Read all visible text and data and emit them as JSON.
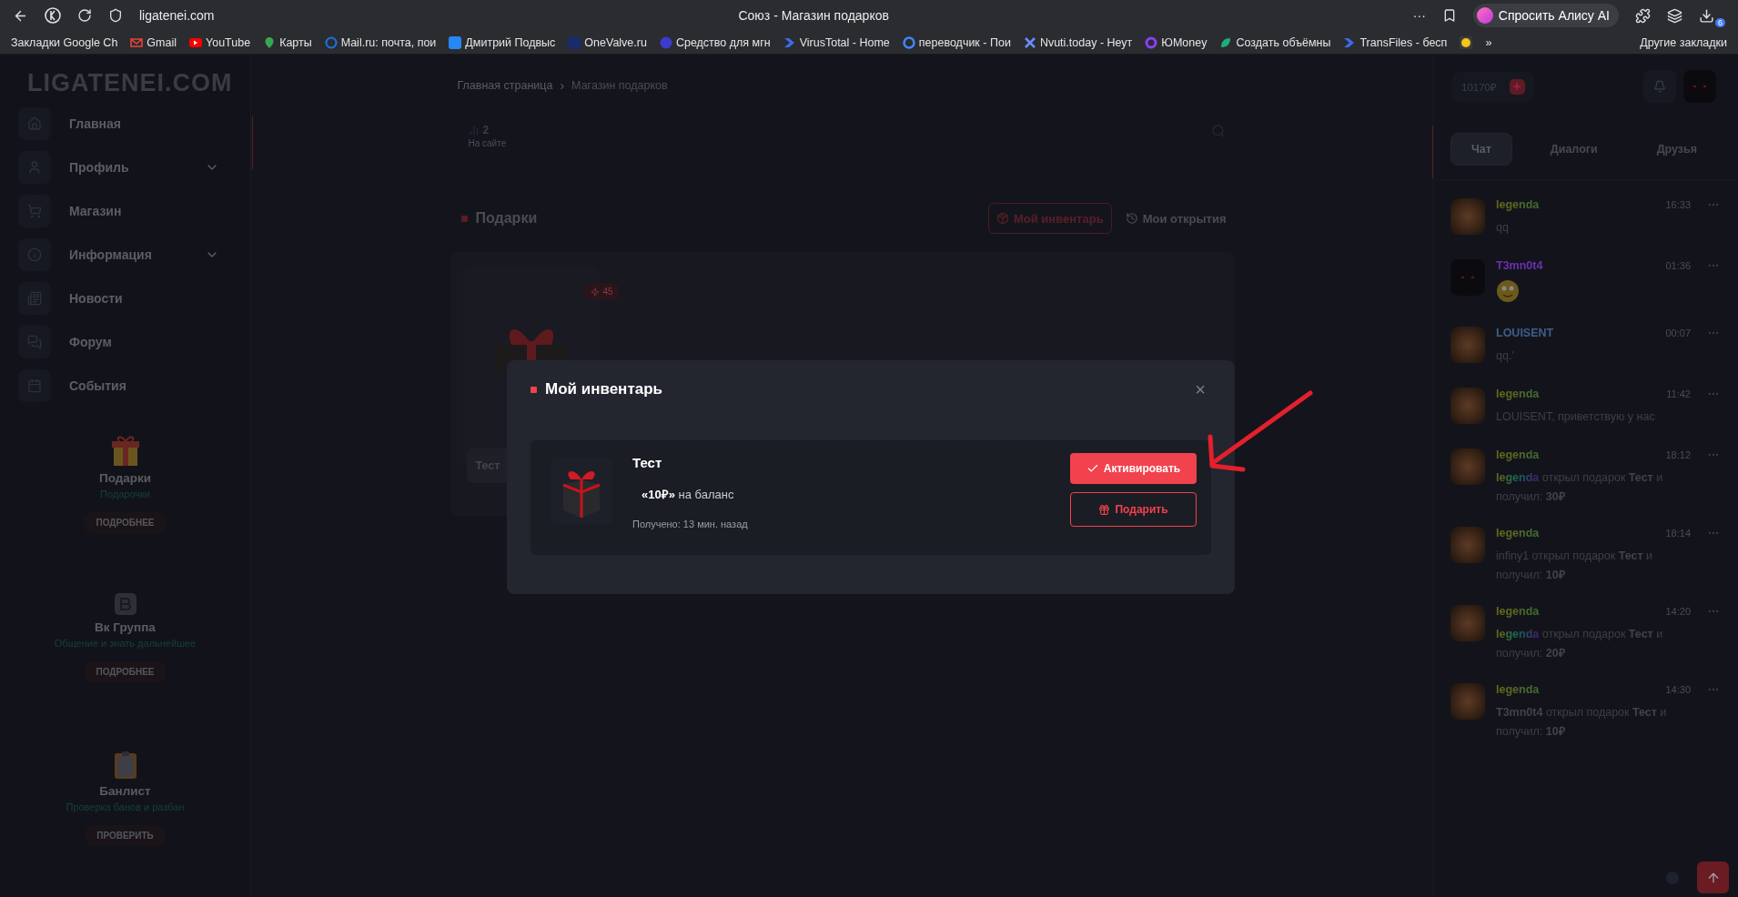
{
  "browser": {
    "address": "ligatenei.com",
    "title": "Союз - Магазин подарков",
    "more": "···",
    "assistant": "Спросить Алису AI",
    "downloads_badge": "6",
    "overflow": "»",
    "other_bookmarks": "Другие закладки",
    "bookmarks": [
      {
        "label": "Закладки Google Ch"
      },
      {
        "label": "Gmail",
        "kind": "mail"
      },
      {
        "label": "YouTube",
        "kind": "play"
      },
      {
        "label": "Карты",
        "kind": "pin"
      },
      {
        "label": "Mail.ru: почта, пои",
        "kind": "at"
      },
      {
        "label": "Дмитрий Подвыс",
        "kind": "vk"
      },
      {
        "label": "OneValve.ru",
        "kind": "square"
      },
      {
        "label": "Средство для мгн",
        "kind": "circle"
      },
      {
        "label": "VirusTotal - Home",
        "kind": "chevron"
      },
      {
        "label": "переводчик - Пои",
        "kind": "google"
      },
      {
        "label": "Nvuti.today - Неут",
        "kind": "cross"
      },
      {
        "label": "ЮMoney",
        "kind": "ring"
      },
      {
        "label": "Создать объёмны",
        "kind": "leaf"
      },
      {
        "label": "TransFiles - бесп",
        "kind": "chevron"
      },
      {
        "kind": "coin"
      }
    ]
  },
  "sidebar": {
    "logo": "LIGATENEI.COM",
    "menu": [
      {
        "label": "Главная",
        "kind": "home"
      },
      {
        "label": "Профиль",
        "kind": "user"
      },
      {
        "label": "Магазин",
        "kind": "cart"
      },
      {
        "label": "Информация",
        "kind": "info"
      },
      {
        "label": "Новости",
        "kind": "news"
      },
      {
        "label": "Форум",
        "kind": "chat"
      },
      {
        "label": "События",
        "kind": "calendar"
      }
    ],
    "cards": [
      {
        "kind": "gift",
        "title": "Подарки",
        "subtitle": "Подарочки",
        "button": "ПОДРОБНЕЕ"
      },
      {
        "kind": "vk",
        "title": "Вк Группа",
        "subtitle": "Общение и знать дальнейшее",
        "button": "ПОДРОБНЕЕ"
      },
      {
        "kind": "clipboard",
        "title": "Банлист",
        "subtitle": "Проверка банов и разбан",
        "button": "ПРОВЕРИТЬ"
      }
    ]
  },
  "main": {
    "breadcrumb": [
      {
        "label": "Главная страница"
      },
      {
        "label": "Магазин подарков"
      }
    ],
    "separator": "›",
    "online": {
      "count": "2",
      "label": "На сайте"
    },
    "section_title": "Подарки",
    "views": [
      {
        "label": "Мой инвентарь",
        "kind": "package",
        "selected": true
      },
      {
        "label": "Мои открытия",
        "kind": "history",
        "selected": false
      }
    ],
    "gift": {
      "badge": "45",
      "button": "Тест"
    }
  },
  "chat": {
    "balance": "10170₽",
    "tabs": [
      {
        "label": "Чат",
        "selected": true
      },
      {
        "label": "Диалоги",
        "selected": false
      },
      {
        "label": "Друзья",
        "selected": false
      }
    ],
    "messages": [
      {
        "avatar": {
          "kind": "portrait"
        },
        "name": {
          "text": "legenda",
          "kind": "rainbow"
        },
        "time": "16:33",
        "kind": "text",
        "text": "qq"
      },
      {
        "avatar": {
          "kind": "dark"
        },
        "name": {
          "text": "T3mn0t4",
          "kind": "plain",
          "color": "#6a30b0"
        },
        "time": "01:36",
        "kind": "emoji"
      },
      {
        "avatar": {
          "kind": "portrait"
        },
        "name": {
          "text": "LOUISENT",
          "kind": "plain",
          "color": "#3d5f8a"
        },
        "time": "00:07",
        "kind": "text",
        "text": "qq.'"
      },
      {
        "avatar": {
          "kind": "portrait"
        },
        "name": {
          "text": "legenda",
          "kind": "rainbow"
        },
        "time": "11:42",
        "kind": "text",
        "text": "LOUISENT, приветствую у нас"
      },
      {
        "avatar": {
          "kind": "portrait"
        },
        "name": {
          "text": "legenda",
          "kind": "rainbow"
        },
        "time": "18:12",
        "kind": "text",
        "actor": "legenda",
        "text": "открыл подарок **Тест** и получил: **30₽**"
      },
      {
        "avatar": {
          "kind": "portrait"
        },
        "name": {
          "text": "legenda",
          "kind": "rainbow"
        },
        "time": "18:14",
        "kind": "text",
        "text": "infiny1 открыл подарок **Тест** и получил: **10₽**"
      },
      {
        "avatar": {
          "kind": "portrait"
        },
        "name": {
          "text": "legenda",
          "kind": "rainbow"
        },
        "time": "14:20",
        "kind": "text",
        "actor": "legenda",
        "text": "открыл подарок **Тест** и получил: **20₽**"
      },
      {
        "avatar": {
          "kind": "portrait"
        },
        "name": {
          "text": "legenda",
          "kind": "rainbow"
        },
        "time": "14:30",
        "kind": "text",
        "text": "**T3mn0t4** открыл подарок **Тест** и получил: **10₽**"
      }
    ]
  },
  "modal": {
    "title": "Мой инвентарь",
    "close": "×",
    "items": [
      {
        "name": "Тест",
        "reward": "**«10₽»** на баланс",
        "received": "Получено: 13 мин. назад",
        "actions": [
          {
            "label": "Активировать",
            "kind": "primary"
          },
          {
            "label": "Подарить",
            "kind": "outline"
          }
        ]
      }
    ]
  }
}
